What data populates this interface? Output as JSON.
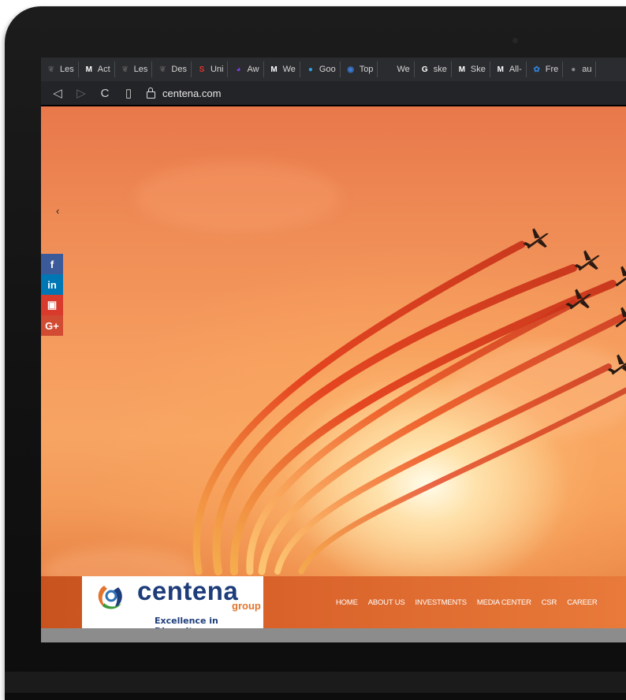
{
  "bookmarks": [
    {
      "label": "Les",
      "icon": "leaf-icon",
      "color": "#555555",
      "glyph": "❦"
    },
    {
      "label": "Act",
      "icon": "medium-icon",
      "color": "#ffffff",
      "glyph": "M"
    },
    {
      "label": "Les",
      "icon": "leaf-icon",
      "color": "#555555",
      "glyph": "❦"
    },
    {
      "label": "Des",
      "icon": "leaf-icon",
      "color": "#555555",
      "glyph": "❦"
    },
    {
      "label": "Uni",
      "icon": "s-brand-icon",
      "color": "#e0322b",
      "glyph": "S"
    },
    {
      "label": "Aw",
      "icon": "purple-orb-icon",
      "color": "#7b3fe4",
      "glyph": "◕"
    },
    {
      "label": "We",
      "icon": "medium-icon",
      "color": "#ffffff",
      "glyph": "M"
    },
    {
      "label": "Goo",
      "icon": "bird-icon",
      "color": "#29a3e0",
      "glyph": "●"
    },
    {
      "label": "Top",
      "icon": "globe-icon",
      "color": "#3a7bd5",
      "glyph": "◉"
    },
    {
      "label": "We",
      "icon": "blank-icon",
      "color": "#2b2c2f",
      "glyph": " "
    },
    {
      "label": "ske",
      "icon": "google-icon",
      "color": "#ffffff",
      "glyph": "G"
    },
    {
      "label": "Ske",
      "icon": "medium-icon",
      "color": "#ffffff",
      "glyph": "M"
    },
    {
      "label": "All-",
      "icon": "medium-icon",
      "color": "#ffffff",
      "glyph": "M"
    },
    {
      "label": "Fre",
      "icon": "angel-icon",
      "color": "#2e7fd6",
      "glyph": "✿"
    },
    {
      "label": "au",
      "icon": "circle-icon",
      "color": "#888888",
      "glyph": "●"
    }
  ],
  "address": {
    "url": "centena.com"
  },
  "nav": {
    "back": "◁",
    "forward": "▷",
    "reload": "C",
    "bookmark": "▯"
  },
  "social": {
    "arrow": "‹",
    "items": [
      {
        "label": "f",
        "name": "facebook-icon",
        "color": "#3b5a9a"
      },
      {
        "label": "in",
        "name": "linkedin-icon",
        "color": "#0077b5"
      },
      {
        "label": "▣",
        "name": "youtube-icon",
        "color": "#d83a2c"
      },
      {
        "label": "G+",
        "name": "google-plus-icon",
        "color": "#d14a32"
      }
    ]
  },
  "logo": {
    "name": "centena",
    "group": "group",
    "tagline": "Excellence in Diversity"
  },
  "menu": [
    "HOME",
    "ABOUT US",
    "INVESTMENTS",
    "MEDIA CENTER",
    "CSR",
    "CAREER"
  ]
}
